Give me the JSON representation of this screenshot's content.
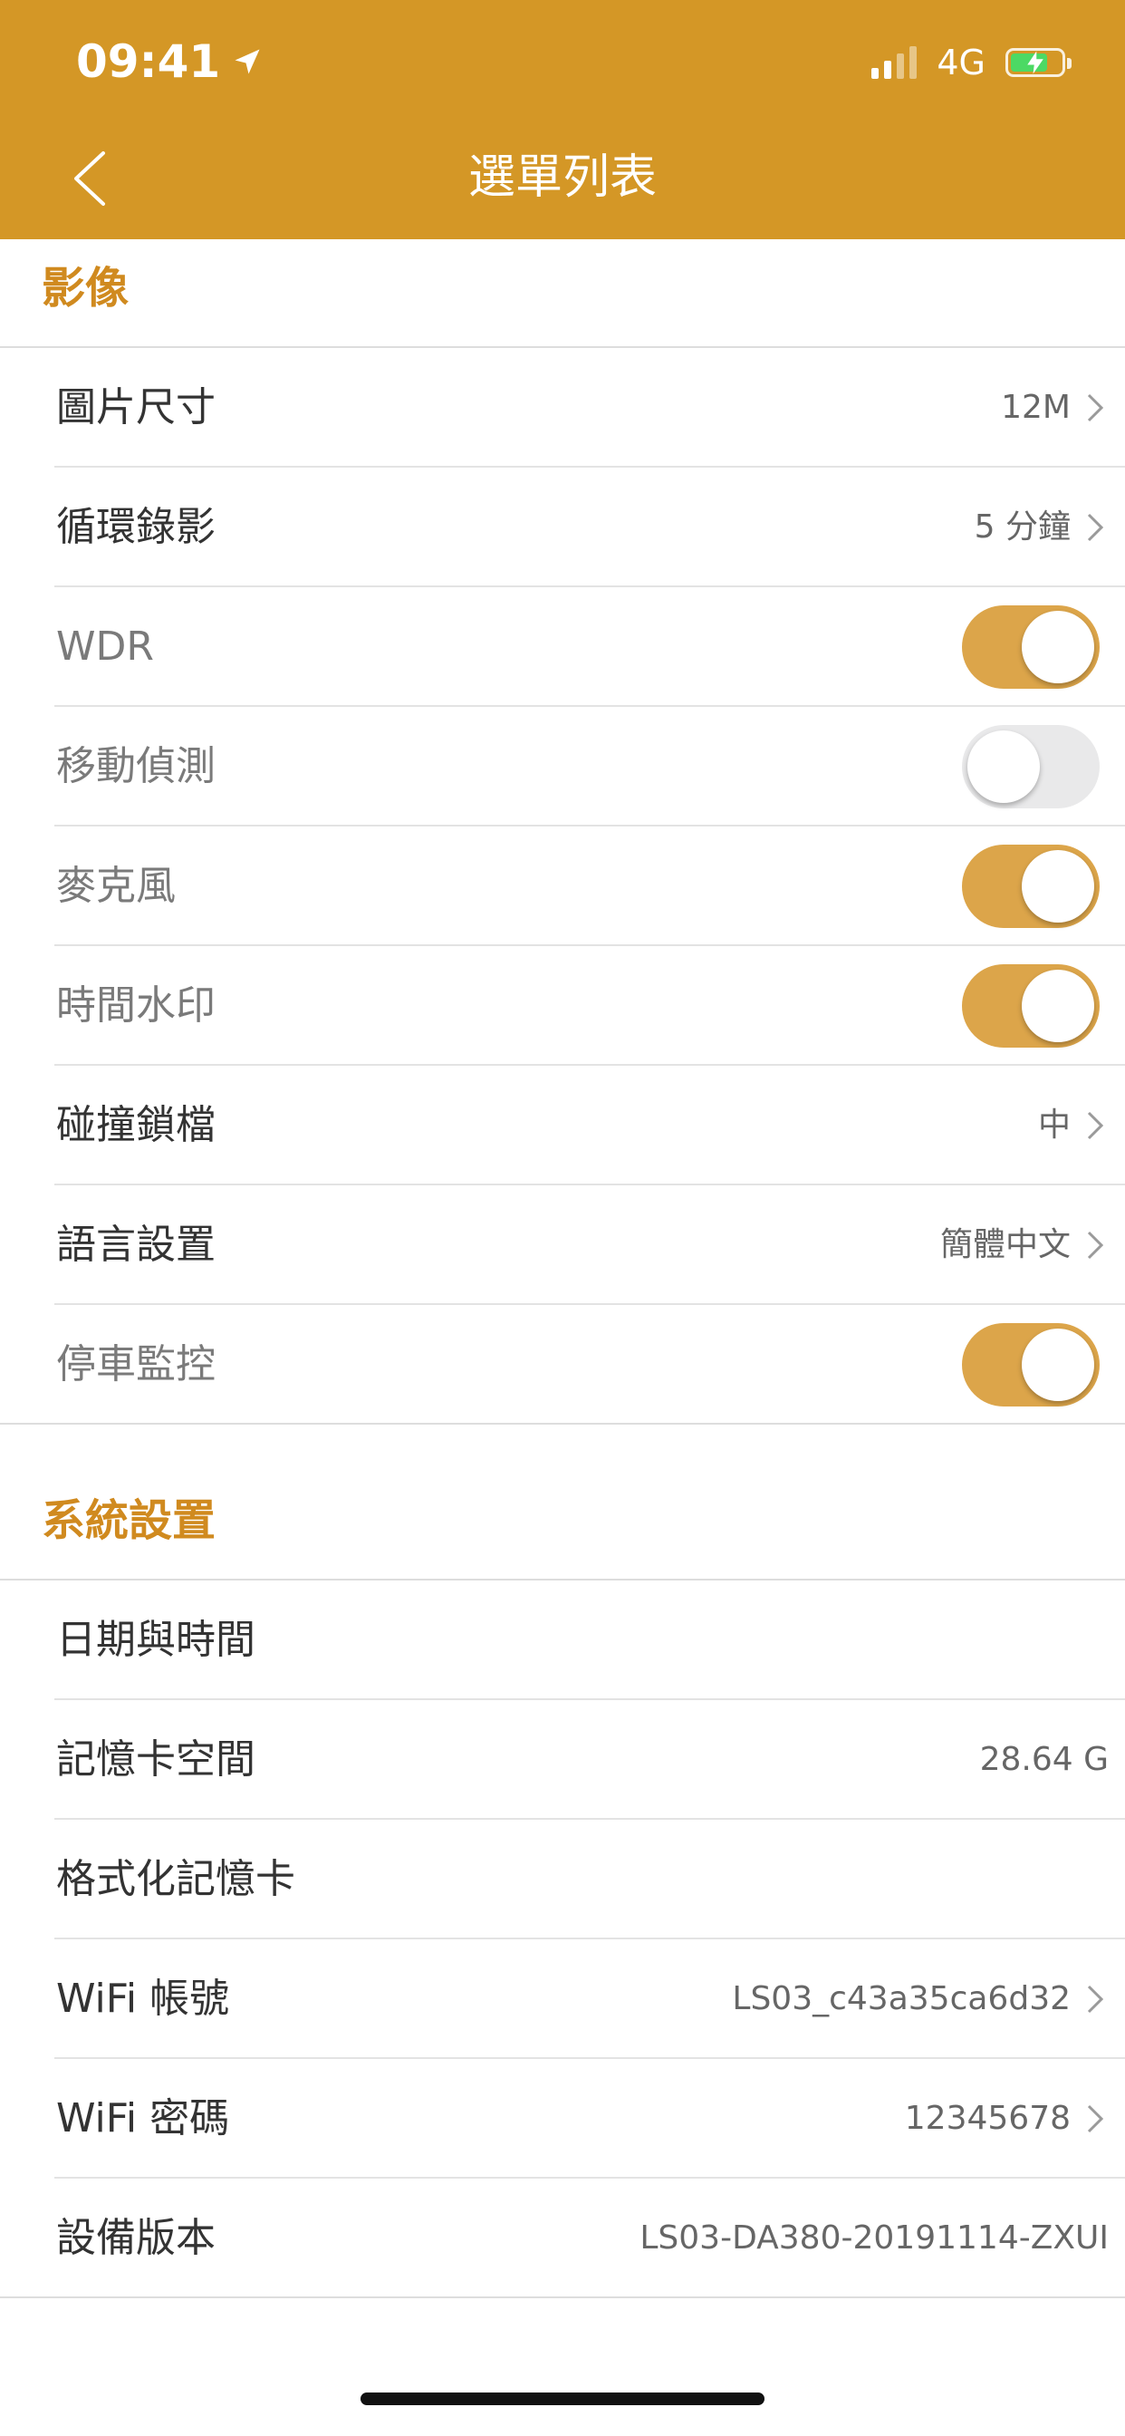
{
  "status_bar": {
    "time": "09:41",
    "network": "4G",
    "location_icon": "location-arrow-icon",
    "battery_icon": "battery-charging-icon"
  },
  "nav": {
    "title": "選單列表",
    "back_icon": "chevron-left-icon"
  },
  "colors": {
    "brand": "#d49726",
    "section_title": "#d08a1f",
    "toggle_on": "#dca54a",
    "toggle_off": "#e9e9ea"
  },
  "video_section": {
    "title": "影像",
    "rows": [
      {
        "label": "圖片尺寸",
        "value": "12M"
      },
      {
        "label": "循環錄影",
        "value": "5 分鐘"
      },
      {
        "label": "WDR",
        "switch_on": true
      },
      {
        "label": "移動偵測",
        "switch_on": false
      },
      {
        "label": "麥克風",
        "switch_on": true
      },
      {
        "label": "時間水印",
        "switch_on": true
      },
      {
        "label": "碰撞鎖檔",
        "value": "中"
      },
      {
        "label": "語言設置",
        "value": "簡體中文"
      },
      {
        "label": "停車監控",
        "switch_on": true
      }
    ]
  },
  "system_section": {
    "title": "系統設置",
    "rows": [
      {
        "label": "日期與時間"
      },
      {
        "label": "記憶卡空間",
        "value": "28.64 G"
      },
      {
        "label": "格式化記憶卡"
      },
      {
        "label": "WiFi 帳號",
        "value": "LS03_c43a35ca6d32"
      },
      {
        "label": "WiFi 密碼",
        "value": "12345678"
      },
      {
        "label": "設備版本",
        "value": "LS03-DA380-20191114-ZXUI"
      }
    ]
  }
}
